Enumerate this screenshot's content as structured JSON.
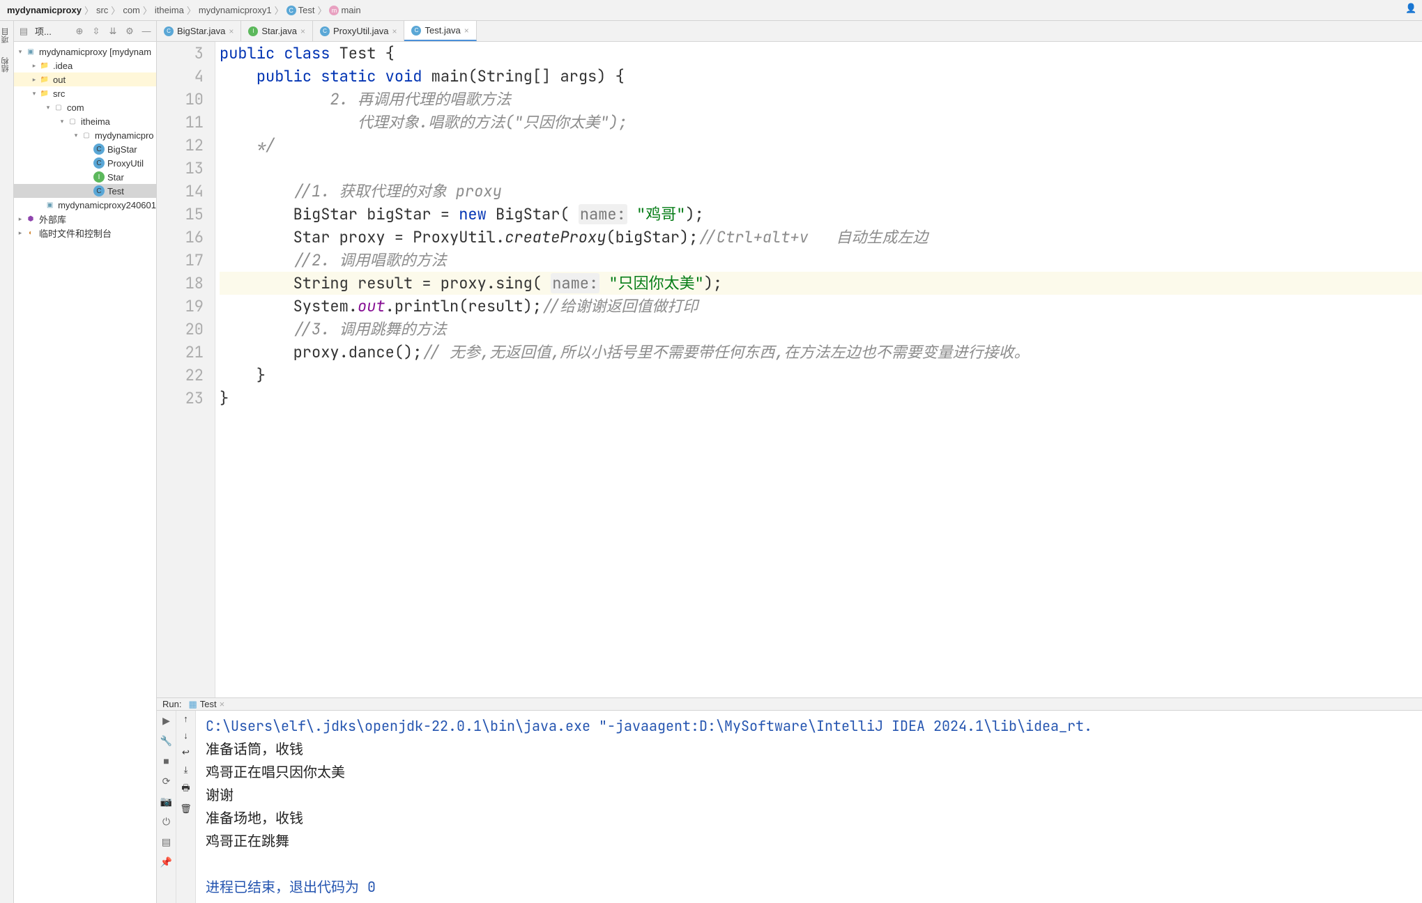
{
  "breadcrumb": {
    "items": [
      "mydynamicproxy",
      "src",
      "com",
      "itheima",
      "mydynamicproxy1"
    ],
    "class": "Test",
    "method": "main"
  },
  "left_stripe": {
    "projects": "项目",
    "structure": "结构"
  },
  "project_toolbar": {
    "title": "项..."
  },
  "tree": {
    "root": "mydynamicproxy [mydynam",
    "idea": ".idea",
    "out": "out",
    "src": "src",
    "com": "com",
    "itheima": "itheima",
    "pkg": "mydynamicpro",
    "files": {
      "bigstar": "BigStar",
      "proxyutil": "ProxyUtil",
      "star": "Star",
      "test": "Test"
    },
    "iml": "mydynamicproxy240601",
    "external": "外部库",
    "scratch": "临时文件和控制台"
  },
  "tabs": [
    {
      "label": "BigStar.java",
      "type": "class"
    },
    {
      "label": "Star.java",
      "type": "interface"
    },
    {
      "label": "ProxyUtil.java",
      "type": "class"
    },
    {
      "label": "Test.java",
      "type": "class",
      "active": true
    }
  ],
  "code": {
    "lines": [
      3,
      4,
      10,
      11,
      12,
      13,
      14,
      15,
      16,
      17,
      18,
      19,
      20,
      21,
      22,
      23
    ],
    "l3_pre": "public class ",
    "l3_name": "Test",
    "l3_post": " {",
    "l4_pre": "    ",
    "l4_kw1": "public static void ",
    "l4_m": "main",
    "l4_post": "(String[] args) {",
    "l10": "            2. 再调用代理的唱歌方法",
    "l11": "               代理对象.唱歌的方法(\"只因你太美\");",
    "l12": "    */",
    "l13": "",
    "l14": "        //1. 获取代理的对象 proxy",
    "l15_a": "        BigStar bigStar = ",
    "l15_new": "new ",
    "l15_b": "BigStar( ",
    "l15_lbl": "name:",
    "l15_str": " \"鸡哥\"",
    "l15_c": ");",
    "l16_a": "        Star proxy = ProxyUtil.",
    "l16_m": "createProxy",
    "l16_b": "(bigStar);",
    "l16_cmt": "//Ctrl+alt+v   自动生成左边",
    "l17": "        //2. 调用唱歌的方法",
    "l18_a": "        String result = proxy.sing( ",
    "l18_lbl": "name:",
    "l18_str": " \"只因你太美\"",
    "l18_b": ");",
    "l19_a": "        System.",
    "l19_out": "out",
    "l19_b": ".println(result);",
    "l19_cmt": "//给谢谢返回值做打印",
    "l20": "        //3. 调用跳舞的方法",
    "l21_a": "        proxy.dance();",
    "l21_cmt": "// 无参,无返回值,所以小括号里不需要带任何东西,在方法左边也不需要变量进行接收。",
    "l22": "    }",
    "l23": "}"
  },
  "run": {
    "label": "Run:",
    "tab": "Test",
    "lines": [
      {
        "cls": "blue",
        "text": "C:\\Users\\elf\\.jdks\\openjdk-22.0.1\\bin\\java.exe \"-javaagent:D:\\MySoftware\\IntelliJ IDEA 2024.1\\lib\\idea_rt."
      },
      {
        "cls": "",
        "text": "准备话筒，收钱"
      },
      {
        "cls": "",
        "text": "鸡哥正在唱只因你太美"
      },
      {
        "cls": "",
        "text": "谢谢"
      },
      {
        "cls": "",
        "text": "准备场地，收钱"
      },
      {
        "cls": "",
        "text": "鸡哥正在跳舞"
      },
      {
        "cls": "",
        "text": ""
      },
      {
        "cls": "blue",
        "text": "进程已结束，退出代码为 0"
      }
    ]
  }
}
